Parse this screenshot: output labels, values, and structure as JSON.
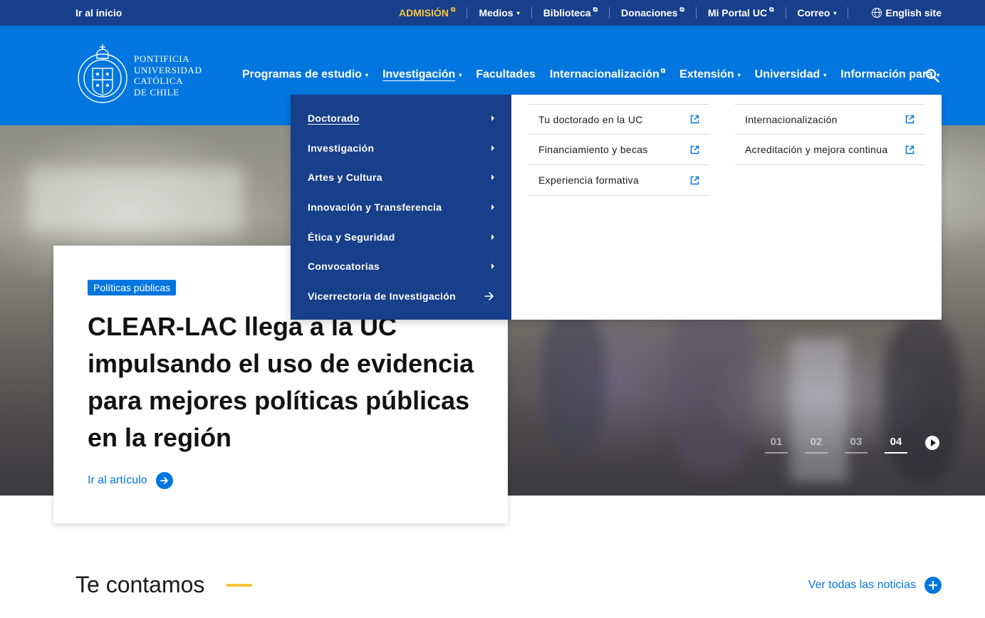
{
  "topbar": {
    "home": "Ir al inicio",
    "items": [
      {
        "label": "ADMISIÓN",
        "ext": "⧉"
      },
      {
        "label": "Medios",
        "caret": "▾"
      },
      {
        "label": "Biblioteca",
        "ext": "⧉"
      },
      {
        "label": "Donaciones",
        "ext": "⧉"
      },
      {
        "label": "Mi Portal UC",
        "ext": "⧉"
      },
      {
        "label": "Correo",
        "caret": "▾"
      }
    ],
    "english": "English site"
  },
  "logo": {
    "line1": "PONTIFICIA",
    "line2": "UNIVERSIDAD",
    "line3": "CATÓLICA",
    "line4": "DE CHILE"
  },
  "nav": {
    "items": [
      {
        "label": "Programas de estudio",
        "caret": "▾"
      },
      {
        "label": "Investigación",
        "caret": "▾"
      },
      {
        "label": "Facultades"
      },
      {
        "label": "Internacionalización",
        "ext": "⧉"
      },
      {
        "label": "Extensión",
        "caret": "▾"
      },
      {
        "label": "Universidad",
        "caret": "▾"
      },
      {
        "label": "Información para",
        "caret": "▾"
      }
    ]
  },
  "dropdown": {
    "left": [
      "Doctorado",
      "Investigación",
      "Artes y Cultura",
      "Innovación y Transferencia",
      "Ética y Seguridad",
      "Convocatorias",
      "Vicerrectoría de Investigación"
    ],
    "col1": [
      "Tu doctorado en la UC",
      "Financiamiento y becas",
      "Experiencia formativa"
    ],
    "col2": [
      "Internacionalización",
      "Acreditación y mejora continua"
    ]
  },
  "hero": {
    "tag": "Políticas públicas",
    "title": "CLEAR-LAC llega a la UC impulsando el uso de evidencia para mejores políticas públicas en la región",
    "link": "Ir al artículo",
    "slides": [
      "01",
      "02",
      "03",
      "04"
    ],
    "active_slide": "04"
  },
  "section": {
    "title": "Te contamos",
    "all_news": "Ver todas las noticias"
  },
  "colors": {
    "topbar": "#173f8a",
    "header": "#0176de",
    "accent": "#f7c53a"
  }
}
